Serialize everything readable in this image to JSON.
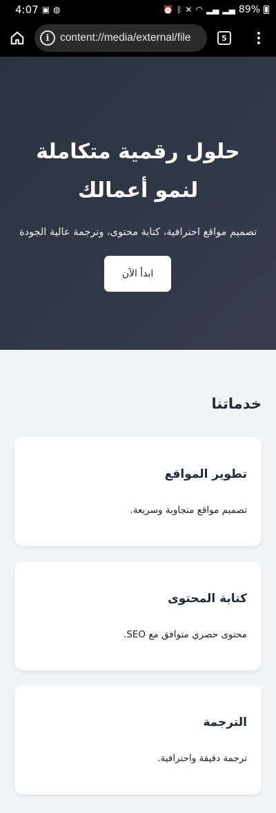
{
  "status_bar": {
    "time": "4:07",
    "battery": "89%"
  },
  "browser": {
    "url": "content://media/external/file",
    "tab_count": "5"
  },
  "hero": {
    "title": "حلول رقمية متكاملة لنمو أعمالك",
    "subtitle": "تصميم مواقع احترافية، كتابة محتوى، وترجمة عالية الجودة",
    "cta_label": "ابدأ الآن",
    "gradient_colors": [
      "#2a3340",
      "#363c4c"
    ]
  },
  "services": {
    "heading": "خدماتنا",
    "items": [
      {
        "title": "تطوير المواقع",
        "description": "تصميم مواقع متجاوبة وسريعة."
      },
      {
        "title": "كتابة المحتوى",
        "description": "محتوى حصري متوافق مع SEO."
      },
      {
        "title": "الترجمة",
        "description": "ترجمة دقيقة واحترافية."
      }
    ]
  }
}
